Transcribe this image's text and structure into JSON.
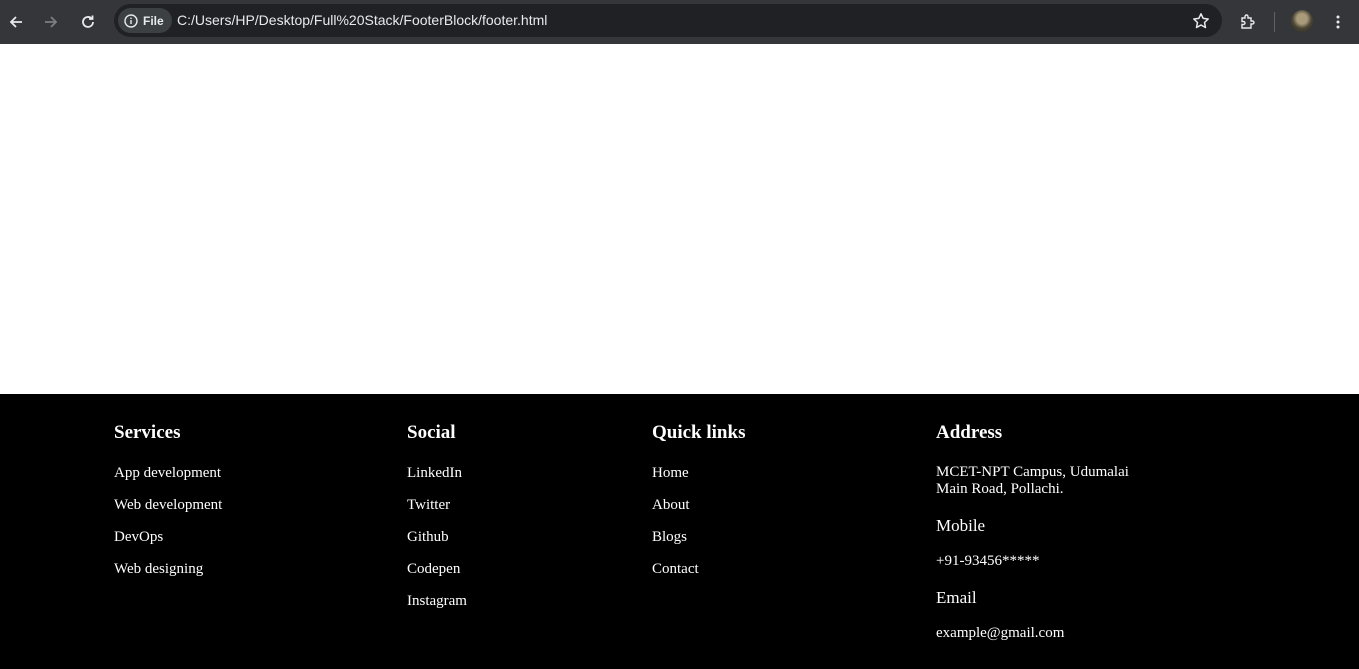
{
  "browser": {
    "site_chip_label": "File",
    "url": "C:/Users/HP/Desktop/Full%20Stack/FooterBlock/footer.html",
    "icons": [
      "back-icon",
      "forward-icon",
      "reload-icon",
      "info-icon",
      "star-icon",
      "extensions-icon",
      "profile-avatar",
      "menu-icon"
    ]
  },
  "footer": {
    "services": {
      "title": "Services",
      "items": [
        "App development",
        "Web development",
        "DevOps",
        "Web designing"
      ]
    },
    "social": {
      "title": "Social",
      "items": [
        "LinkedIn",
        "Twitter",
        "Github",
        "Codepen",
        "Instagram"
      ]
    },
    "quick_links": {
      "title": "Quick links",
      "items": [
        "Home",
        "About",
        "Blogs",
        "Contact"
      ]
    },
    "address": {
      "title": "Address",
      "line": "MCET-NPT Campus, Udumalai Main Road, Pollachi.",
      "mobile_label": "Mobile",
      "mobile_value": "+91-93456*****",
      "email_label": "Email",
      "email_value": "example@gmail.com"
    }
  },
  "colors": {
    "toolbar": "#35363a",
    "omnibox": "#202124",
    "footer_bg": "#000000",
    "footer_text": "#ffffff"
  }
}
